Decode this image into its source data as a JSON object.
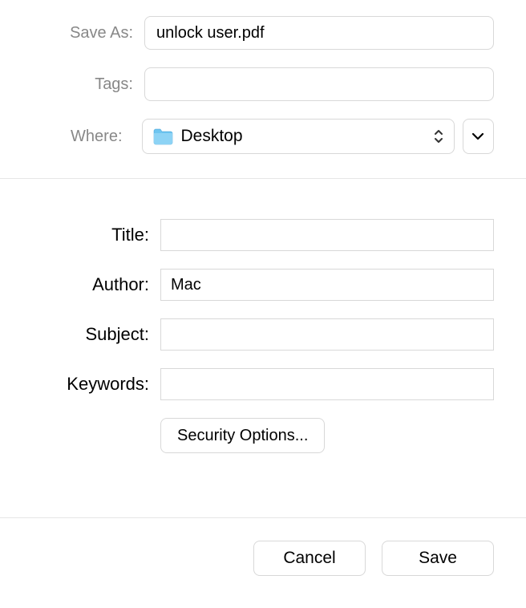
{
  "saveAs": {
    "label": "Save As:",
    "value": "unlock user.pdf"
  },
  "tags": {
    "label": "Tags:",
    "value": ""
  },
  "where": {
    "label": "Where:",
    "selected": "Desktop"
  },
  "meta": {
    "title": {
      "label": "Title:",
      "value": ""
    },
    "author": {
      "label": "Author:",
      "value": "Mac"
    },
    "subject": {
      "label": "Subject:",
      "value": ""
    },
    "keywords": {
      "label": "Keywords:",
      "value": ""
    }
  },
  "buttons": {
    "security": "Security Options...",
    "cancel": "Cancel",
    "save": "Save"
  }
}
